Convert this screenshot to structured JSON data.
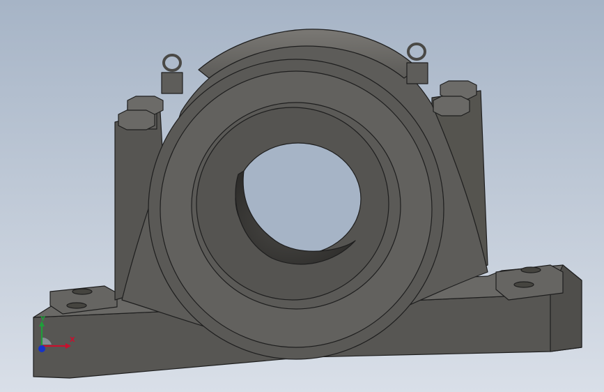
{
  "viewport": {
    "background_top": "#a6b4c6",
    "background_bottom": "#d9dfe8",
    "model_color": "#5b5a57",
    "model_edge_color": "#1e1e1e"
  },
  "model": {
    "part_type": "pillow-block-bearing-housing"
  },
  "triad": {
    "x_label": "X",
    "y_label": "Y",
    "x_color": "#c8102e",
    "y_color": "#1f9e3a",
    "z_color": "#1533c9"
  }
}
